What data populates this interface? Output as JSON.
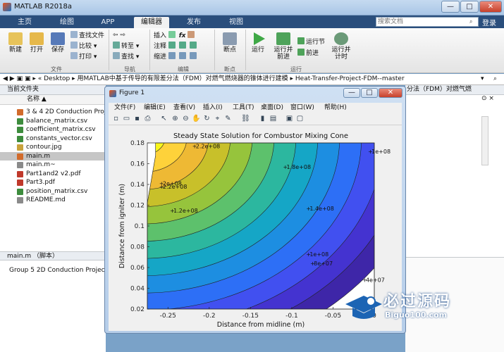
{
  "app": {
    "title": "MATLAB R2018a"
  },
  "tabs": [
    {
      "label": "主页"
    },
    {
      "label": "绘图"
    },
    {
      "label": "APP"
    },
    {
      "label": "编辑器"
    },
    {
      "label": "发布"
    },
    {
      "label": "视图"
    }
  ],
  "search": {
    "placeholder": "搜索文档"
  },
  "login": "登录",
  "ribbon": {
    "new": "新建",
    "open": "打开",
    "save": "保存",
    "find_files": "查找文件",
    "compare": "比较",
    "print": "打印",
    "goto": "转至",
    "find": "查找",
    "insert": "插入",
    "comment": "注释",
    "indent": "缩进",
    "fx": "fx",
    "breakpoints": "断点",
    "run": "运行",
    "run_advance": "运行并\n前进",
    "run_section": "运行节",
    "advance": "前进",
    "run_time": "运行并\n计时",
    "groups": {
      "file": "文件",
      "nav": "导航",
      "edit": "编辑",
      "bp": "断点",
      "run": "运行"
    }
  },
  "path": {
    "segments": [
      "Desktop",
      "用MATLAB中基于传导的有限差分法（FDM）对燃气燃烧器的锥体进行建模",
      "Heat-Transfer-Project-FDM--master"
    ]
  },
  "current_folder": {
    "header": "当前文件夹",
    "column": "名称",
    "sort_arrow": "▲",
    "files": [
      {
        "name": "3 & 4 2D Conduction Project",
        "type": "m",
        "selected": false
      },
      {
        "name": "balance_matrix.csv",
        "type": "csv",
        "selected": false
      },
      {
        "name": "coefficient_matrix.csv",
        "type": "csv",
        "selected": false
      },
      {
        "name": "constants_vector.csv",
        "type": "csv",
        "selected": false
      },
      {
        "name": "contour.jpg",
        "type": "jpg",
        "selected": false
      },
      {
        "name": "main.m",
        "type": "m",
        "selected": true
      },
      {
        "name": "main.m~",
        "type": "txt",
        "selected": false
      },
      {
        "name": "Part1and2 v2.pdf",
        "type": "pdf",
        "selected": false
      },
      {
        "name": "Part3.pdf",
        "type": "pdf",
        "selected": false
      },
      {
        "name": "position_matrix.csv",
        "type": "csv",
        "selected": false
      },
      {
        "name": "README.md",
        "type": "txt",
        "selected": false
      }
    ]
  },
  "details": {
    "header": "main.m （脚本）",
    "text": "Group 5 2D Conduction Project"
  },
  "right_panel": {
    "header": "分法（FDM）对燃气燃"
  },
  "figure": {
    "title": "Figure 1",
    "menu": [
      "文件(F)",
      "编辑(E)",
      "查看(V)",
      "插入(I)",
      "工具(T)",
      "桌面(D)",
      "窗口(W)",
      "帮助(H)"
    ]
  },
  "chart_data": {
    "type": "contour",
    "title": "Steady State Solution for Combustor Mixing Cone",
    "xlabel": "Distance from midline (m)",
    "ylabel": "Distance from igniter (m)",
    "xlim": [
      -0.275,
      0.0
    ],
    "ylim": [
      0.02,
      0.18
    ],
    "xticks": [
      -0.25,
      -0.2,
      -0.15,
      -0.1,
      -0.05,
      0
    ],
    "yticks": [
      0.02,
      0.04,
      0.06,
      0.08,
      0.1,
      0.12,
      0.14,
      0.16,
      0.18
    ],
    "colormap": [
      "#3e26a8",
      "#4433d0",
      "#4150f0",
      "#2d6ff6",
      "#1d8ee1",
      "#15a6c6",
      "#2cb79f",
      "#5dc16c",
      "#96c43c",
      "#c8c02a",
      "#eeb934",
      "#fed23a",
      "#f9f71a"
    ],
    "boundary": [
      [
        -0.275,
        0.02
      ],
      [
        -0.275,
        0.122
      ],
      [
        -0.265,
        0.168
      ],
      [
        -0.265,
        0.18
      ],
      [
        0.0,
        0.18
      ],
      [
        0.0,
        0.02
      ]
    ],
    "labels": [
      {
        "text": "2.2e+08",
        "x": -0.218,
        "y": 0.177
      },
      {
        "text": "1e+08",
        "x": -0.005,
        "y": 0.172
      },
      {
        "text": "1.8e+08",
        "x": -0.108,
        "y": 0.157
      },
      {
        "text": "2e+08",
        "x": -0.258,
        "y": 0.141
      },
      {
        "text": "2.2e+08",
        "x": -0.258,
        "y": 0.138
      },
      {
        "text": "1.2e+08",
        "x": -0.245,
        "y": 0.115
      },
      {
        "text": "1.4e+08",
        "x": -0.08,
        "y": 0.117
      },
      {
        "text": "1e+08",
        "x": -0.08,
        "y": 0.073
      },
      {
        "text": "8e+07",
        "x": -0.075,
        "y": 0.064
      },
      {
        "text": "4e+07",
        "x": -0.012,
        "y": 0.048
      }
    ]
  },
  "watermark": {
    "main": "必过源码",
    "sub": "Biguo100.com"
  }
}
